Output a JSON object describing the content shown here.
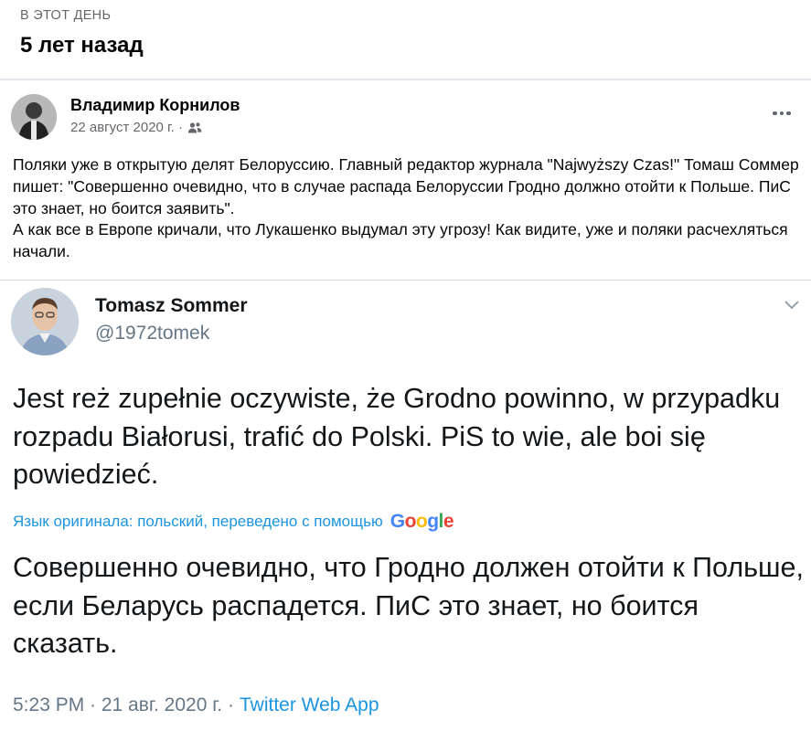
{
  "memory": {
    "label": "В ЭТОТ ДЕНЬ",
    "title": "5 лет назад"
  },
  "post": {
    "author": "Владимир Корнилов",
    "date": "22 август 2020 г. ·",
    "audience_icon": "friends-icon",
    "more_icon": "more-options-icon",
    "text": "Поляки уже в открытую делят Белоруссию. Главный редактор журнала \"Najwyższy Czas!\" Томаш Соммер пишет: \"Совершенно очевидно, что в случае распада Белоруссии Гродно должно отойти к Польше. ПиС это знает, но боится заявить\".\nА как все в Европе кричали, что Лукашенко выдумал эту угрозу! Как видите, уже и поляки расчехляться начали."
  },
  "tweet": {
    "name": "Tomasz Sommer",
    "handle": "@1972tomek",
    "chevron_icon": "chevron-down-icon",
    "original_text": "Jest reż zupełnie oczywiste, że Grodno powinno, w przypadku rozpadu Białorusi, trafić do Polski. PiS to wie, ale boi się powiedzieć.",
    "translation_note": "Язык оригинала: польский, переведено с помощью",
    "translation_brand": "Google",
    "translated_text": "Совершенно очевидно, что Гродно должен отойти к Польше, если Беларусь распадется. ПиС это знает, но боится сказать.",
    "time": "5:23 PM · 21 авг. 2020 г. ·",
    "source": "Twitter Web App"
  },
  "colors": {
    "link_blue": "#1b95e0",
    "meta_gray": "#65676b",
    "divider": "#e4e6eb"
  }
}
